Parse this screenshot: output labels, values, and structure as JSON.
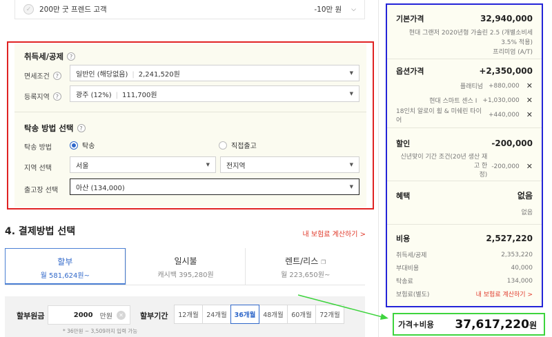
{
  "top_row": {
    "label": "200만 굿 프렌드 고객",
    "value": "-10만 원"
  },
  "tax": {
    "title": "취득세/공제",
    "exemption": {
      "label": "면세조건",
      "value": "일반인 (해당없음)",
      "amount": "2,241,520원"
    },
    "region": {
      "label": "등록지역",
      "value": "광주 (12%)",
      "amount": "111,700원"
    }
  },
  "delivery": {
    "title": "탁송 방법 선택",
    "method_label": "탁송 방법",
    "options": [
      "탁송",
      "직접출고"
    ],
    "region_label": "지역 선택",
    "region_city": "서울",
    "region_district": "전지역",
    "factory_label": "출고장 선택",
    "factory_value": "아산 (134,000)"
  },
  "payment": {
    "title": "4. 결제방법 선택",
    "calc_link": "내 보험료 계산하기 >",
    "tabs": [
      {
        "title": "할부",
        "sub": "월 581,624원~"
      },
      {
        "title": "일시불",
        "sub": "캐시백 395,280원"
      },
      {
        "title": "렌트/리스",
        "sub": "월 223,650원~"
      }
    ],
    "installment": {
      "principal_label": "할부원금",
      "amount": "2000",
      "unit": "만원",
      "hint": "* 36만원 ~ 3,509까지 입력 가능",
      "period_label": "할부기간",
      "periods": [
        "12개월",
        "24개월",
        "36개월",
        "48개월",
        "60개월",
        "72개월"
      ],
      "selected_period": "36개월"
    }
  },
  "summary": {
    "base": {
      "label": "기본가격",
      "value": "32,940,000",
      "desc1": "현대 그랜저 2020년형 가솔린 2.5 (개별소비세 3.5% 적용)",
      "desc2": "프리미엄 (A/T)"
    },
    "options": {
      "label": "옵션가격",
      "value": "+2,350,000",
      "items": [
        {
          "name": "플래티넘",
          "price": "+880,000"
        },
        {
          "name": "현대 스마트 센스 I",
          "price": "+1,030,000"
        },
        {
          "name": "18인치 알로이 휠 & 미쉐린 타이어",
          "price": "+440,000"
        }
      ]
    },
    "discount": {
      "label": "할인",
      "value": "-200,000",
      "item_name1": "신년맞이 기간 조건(20년 생산 재고 한",
      "item_name2": "정)",
      "item_price": "-200,000"
    },
    "benefit": {
      "label": "혜택",
      "value": "없음",
      "sub": "없음"
    },
    "cost": {
      "label": "비용",
      "value": "2,527,220",
      "rows": [
        {
          "name": "취득세/공제",
          "value": "2,353,220"
        },
        {
          "name": "부대비용",
          "value": "40,000"
        },
        {
          "name": "탁송료",
          "value": "134,000"
        },
        {
          "name": "보험료(별도)",
          "value": "내 보험료 계산하기 >"
        }
      ]
    },
    "total": {
      "label": "가격+비용",
      "value": "37,617,220",
      "unit": "원"
    }
  },
  "colors": {
    "red_box": "#e02222",
    "blue_box": "#2323d8",
    "green_box": "#3dd43d",
    "accent_blue": "#2f67c9",
    "link_red": "#e03a2b"
  }
}
